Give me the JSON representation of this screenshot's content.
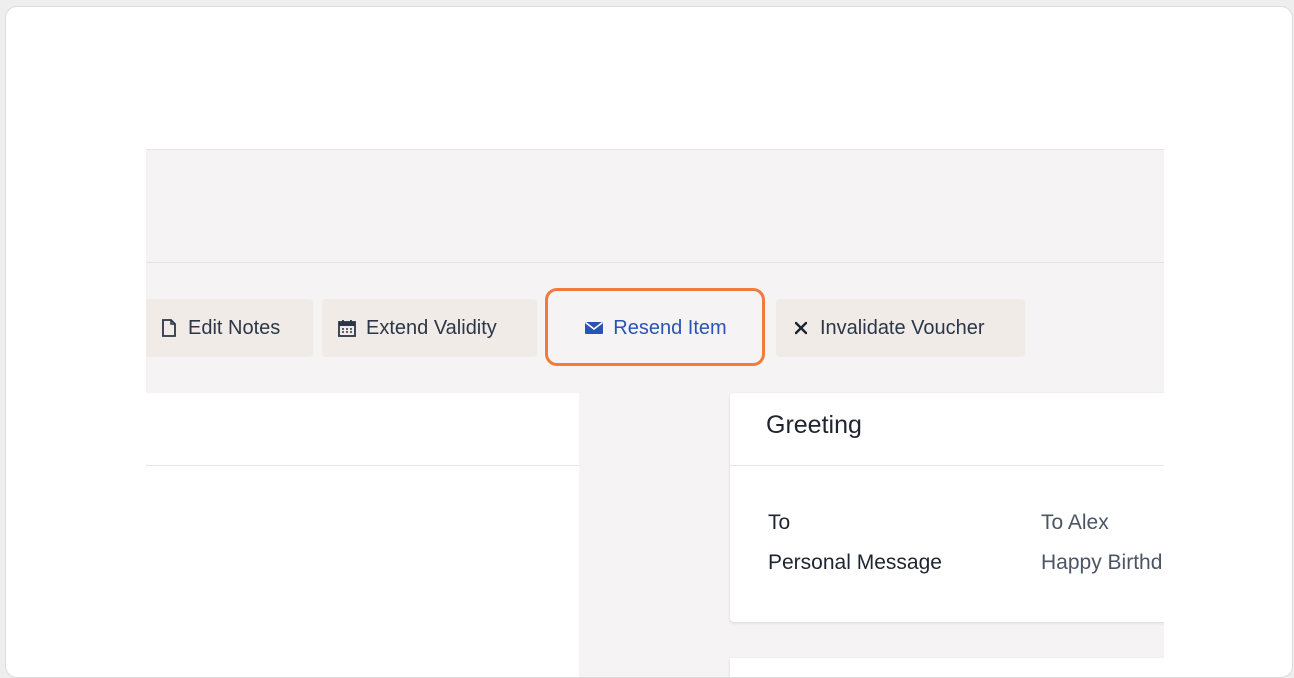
{
  "toolbar": {
    "edit_notes": "Edit Notes",
    "extend_validity": "Extend Validity",
    "resend_item": "Resend Item",
    "invalidate_voucher": "Invalidate Voucher"
  },
  "greeting": {
    "title": "Greeting",
    "rows": [
      {
        "label": "To",
        "value": "To Alex"
      },
      {
        "label": "Personal Message",
        "value": "Happy Birthd"
      }
    ]
  },
  "colors": {
    "highlight": "#f27a3a",
    "link_blue": "#2a54b4",
    "button_bg": "#f1ebe8"
  }
}
